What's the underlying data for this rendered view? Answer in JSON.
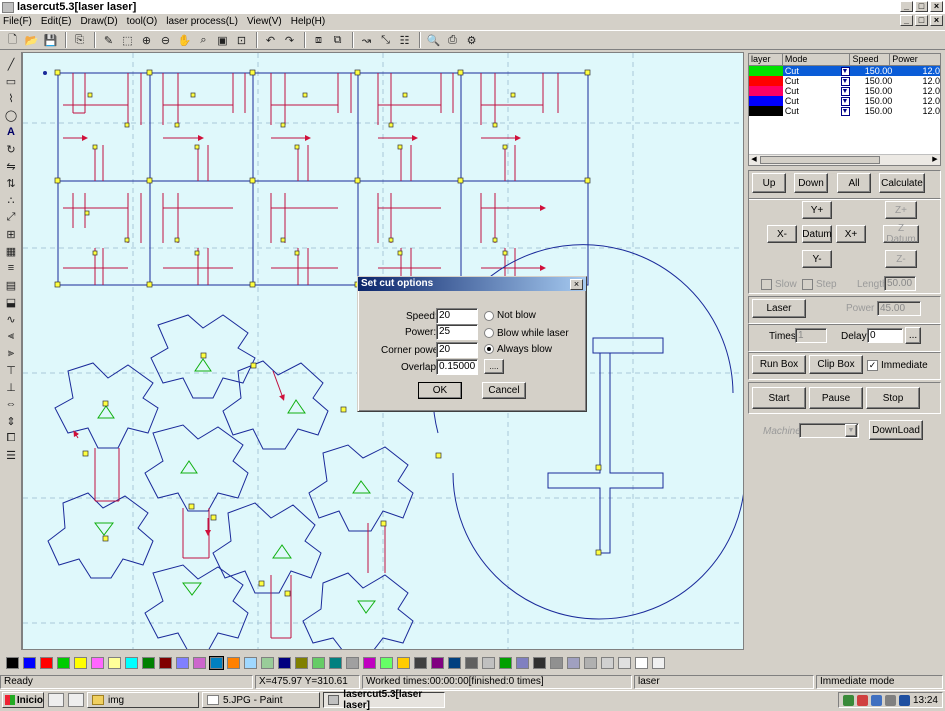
{
  "window": {
    "title": "lasercut5.3[laser laser]"
  },
  "menu": [
    "File(F)",
    "Edit(E)",
    "Draw(D)",
    "tool(O)",
    "laser process(L)",
    "View(V)",
    "Help(H)"
  ],
  "layer_table": {
    "headers": [
      "layer",
      "Mode",
      "Speed",
      "Power"
    ],
    "rows": [
      {
        "color": "#00e000",
        "mode": "Cut",
        "speed": "150.00",
        "power": "12.0"
      },
      {
        "color": "#ff0000",
        "mode": "Cut",
        "speed": "150.00",
        "power": "12.0"
      },
      {
        "color": "#ff0066",
        "mode": "Cut",
        "speed": "150.00",
        "power": "12.0"
      },
      {
        "color": "#0000ff",
        "mode": "Cut",
        "speed": "150.00",
        "power": "12.0"
      },
      {
        "color": "#000000",
        "mode": "Cut",
        "speed": "150.00",
        "power": "12.0"
      }
    ]
  },
  "layer_buttons": {
    "up": "Up",
    "down": "Down",
    "all": "All",
    "calculate": "Calculate"
  },
  "move": {
    "yplus": "Y+",
    "xminus": "X-",
    "datum": "Datum",
    "xplus": "X+",
    "yminus": "Y-",
    "zplus": "Z+",
    "zdatum": "Z Datum",
    "zminus": "Z-"
  },
  "options": {
    "slow": "Slow",
    "step": "Step",
    "length_label": "Length",
    "length_value": "50.00"
  },
  "laser": {
    "button": "Laser",
    "power_label": "Power",
    "power_value": "45.00"
  },
  "times": {
    "label": "Times:",
    "value": "1",
    "delay_label": "Delay:",
    "delay_value": "0",
    "more": "..."
  },
  "runbox": {
    "run_box": "Run Box",
    "clip_box": "Clip Box",
    "immediate": "Immediate"
  },
  "control": {
    "start": "Start",
    "pause": "Pause",
    "stop": "Stop"
  },
  "machine": {
    "label": "Machine",
    "download": "DownLoad"
  },
  "dialog": {
    "title": "Set cut options",
    "speed_label": "Speed:",
    "speed_value": "20",
    "power_label": "Power:",
    "power_value": "25",
    "corner_label": "Corner power:",
    "corner_value": "20",
    "overlap_label": "Overlap:",
    "overlap_value": "0.15000",
    "overlap_more": "....",
    "opt_not_blow": "Not blow",
    "opt_blow_laser": "Blow while laser",
    "opt_always": "Always blow",
    "ok": "OK",
    "cancel": "Cancel"
  },
  "palette": [
    "#000000",
    "#0000ff",
    "#ff0000",
    "#00cc00",
    "#ffff00",
    "#ff66ff",
    "#ffff99",
    "#00ffff",
    "#008000",
    "#800000",
    "#8080ff",
    "#cc66cc",
    "#0080c0",
    "#ff8000",
    "#a0d8ff",
    "#99cc99",
    "#000080",
    "#808000",
    "#66cc66",
    "#008080",
    "#a0a0a0",
    "#c000c0",
    "#66ff66",
    "#ffcc00",
    "#404040",
    "#800080",
    "#004080",
    "#606060",
    "#c0c0c0",
    "#00a000",
    "#8080c0",
    "#303030",
    "#909090",
    "#a0a0c0",
    "#b0b0b0",
    "#d0d0d0",
    "#e0e0e0",
    "#ffffff",
    "#f0f0f0"
  ],
  "status": {
    "ready": "Ready",
    "coords": "X=475.97 Y=310.61",
    "worked": "Worked times:00:00:00[finished:0 times]",
    "device": "laser",
    "mode": "Immediate mode"
  },
  "taskbar": {
    "start": "Inicio",
    "tasks": [
      "img",
      "5.JPG - Paint",
      "lasercut5.3[laser laser]"
    ],
    "clock": "13:24"
  }
}
